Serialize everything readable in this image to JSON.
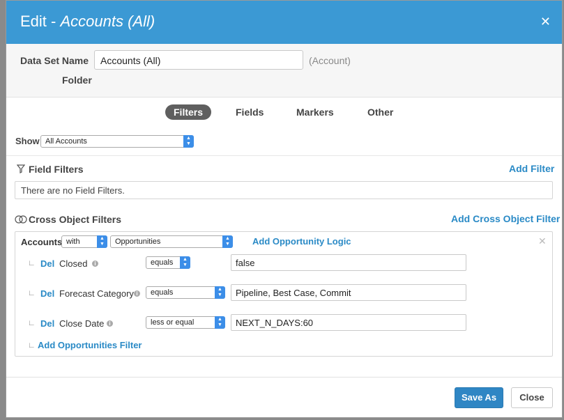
{
  "header": {
    "title_prefix": "Edit - ",
    "title_name": "Accounts (All)",
    "close_glyph": "✕"
  },
  "dataset": {
    "name_label": "Data Set Name",
    "name_value": "Accounts (All)",
    "object_label": "(Account)",
    "folder_label": "Folder"
  },
  "tabs": [
    {
      "label": "Filters",
      "active": true
    },
    {
      "label": "Fields"
    },
    {
      "label": "Markers"
    },
    {
      "label": "Other"
    }
  ],
  "show": {
    "label": "Show",
    "selected": "All Accounts"
  },
  "field_filters": {
    "title": "Field Filters",
    "add_label": "Add Filter",
    "empty_text": "There are no Field Filters."
  },
  "cross_object": {
    "title": "Cross Object Filters",
    "add_label": "Add Cross Object Filter",
    "accounts_label": "Accounts",
    "with_value": "with",
    "object_value": "Opportunities",
    "logic_label": "Add Opportunity Logic",
    "rows": [
      {
        "del": "Del",
        "field": "Closed",
        "operator": "equals",
        "value": "false"
      },
      {
        "del": "Del",
        "field": "Forecast Category",
        "operator": "equals",
        "value": "Pipeline, Best Case, Commit"
      },
      {
        "del": "Del",
        "field": "Close Date",
        "operator": "less or equal",
        "value": "NEXT_N_DAYS:60"
      }
    ],
    "add_filter_label": "Add Opportunities Filter"
  },
  "footer": {
    "save_as": "Save As",
    "close": "Close"
  },
  "colors": {
    "header": "#3b99d4",
    "link": "#2a8ac6",
    "primary": "#2f86c4"
  }
}
